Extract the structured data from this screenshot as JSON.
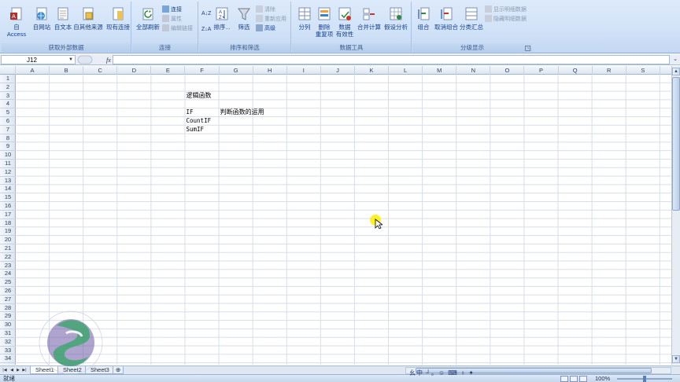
{
  "ribbon": {
    "groups": [
      {
        "label": "获取外部数据",
        "buttons": [
          "自 Access",
          "自网站",
          "自文本",
          "自其他来源",
          "现有连接"
        ]
      },
      {
        "label": "连接",
        "buttons": [
          "全部刷新"
        ],
        "small": [
          "连接",
          "属性",
          "编辑链接"
        ]
      },
      {
        "label": "排序和筛选",
        "buttons": [
          "排序...",
          "筛选"
        ],
        "small": [
          "清除",
          "重新应用",
          "高级"
        ]
      },
      {
        "label": "数据工具",
        "buttons": [
          "分列",
          "删除\n重复项",
          "数据\n有效性",
          "合并计算",
          "假设分析"
        ]
      },
      {
        "label": "分级显示",
        "buttons": [
          "组合",
          "取消组合",
          "分类汇总"
        ],
        "small": [
          "显示明细数据",
          "隐藏明细数据"
        ]
      }
    ]
  },
  "formula_bar": {
    "name_box": "J12",
    "fx": "fx",
    "content": ""
  },
  "columns": [
    "A",
    "B",
    "C",
    "D",
    "E",
    "F",
    "G",
    "H",
    "I",
    "J",
    "K",
    "L",
    "M",
    "N",
    "O",
    "P",
    "Q",
    "R",
    "S"
  ],
  "rows": [
    "1",
    "2",
    "3",
    "4",
    "5",
    "6",
    "7",
    "8",
    "9",
    "10",
    "11",
    "12",
    "13",
    "14",
    "15",
    "16",
    "17",
    "18",
    "19",
    "20",
    "21",
    "22",
    "23",
    "24",
    "25",
    "26",
    "27",
    "28",
    "29",
    "30",
    "31",
    "32",
    "33",
    "34"
  ],
  "cells": {
    "F3": "逻辑函数",
    "F5": "IF",
    "G5": "判断函数的运用",
    "F6": "CountIF",
    "F7": "SumIF"
  },
  "sheets": [
    "Sheet1",
    "Sheet2",
    "Sheet3"
  ],
  "active_sheet": "Sheet1",
  "status": {
    "mode": "就绪",
    "zoom": "100%",
    "ime": "⺓中 ┘。☺ ⌨ ♀ ✦"
  },
  "watermark": {
    "text_left": "SCHOOL",
    "text_top": "深圳时代职业培训学校",
    "text_right": "SHENZHEN"
  },
  "colors": {
    "ribbon": "#d2e3f8",
    "accent": "#15428b",
    "grid": "#d6dee8",
    "logo_green": "#3aa56b",
    "logo_purple": "#6c5aa6"
  }
}
